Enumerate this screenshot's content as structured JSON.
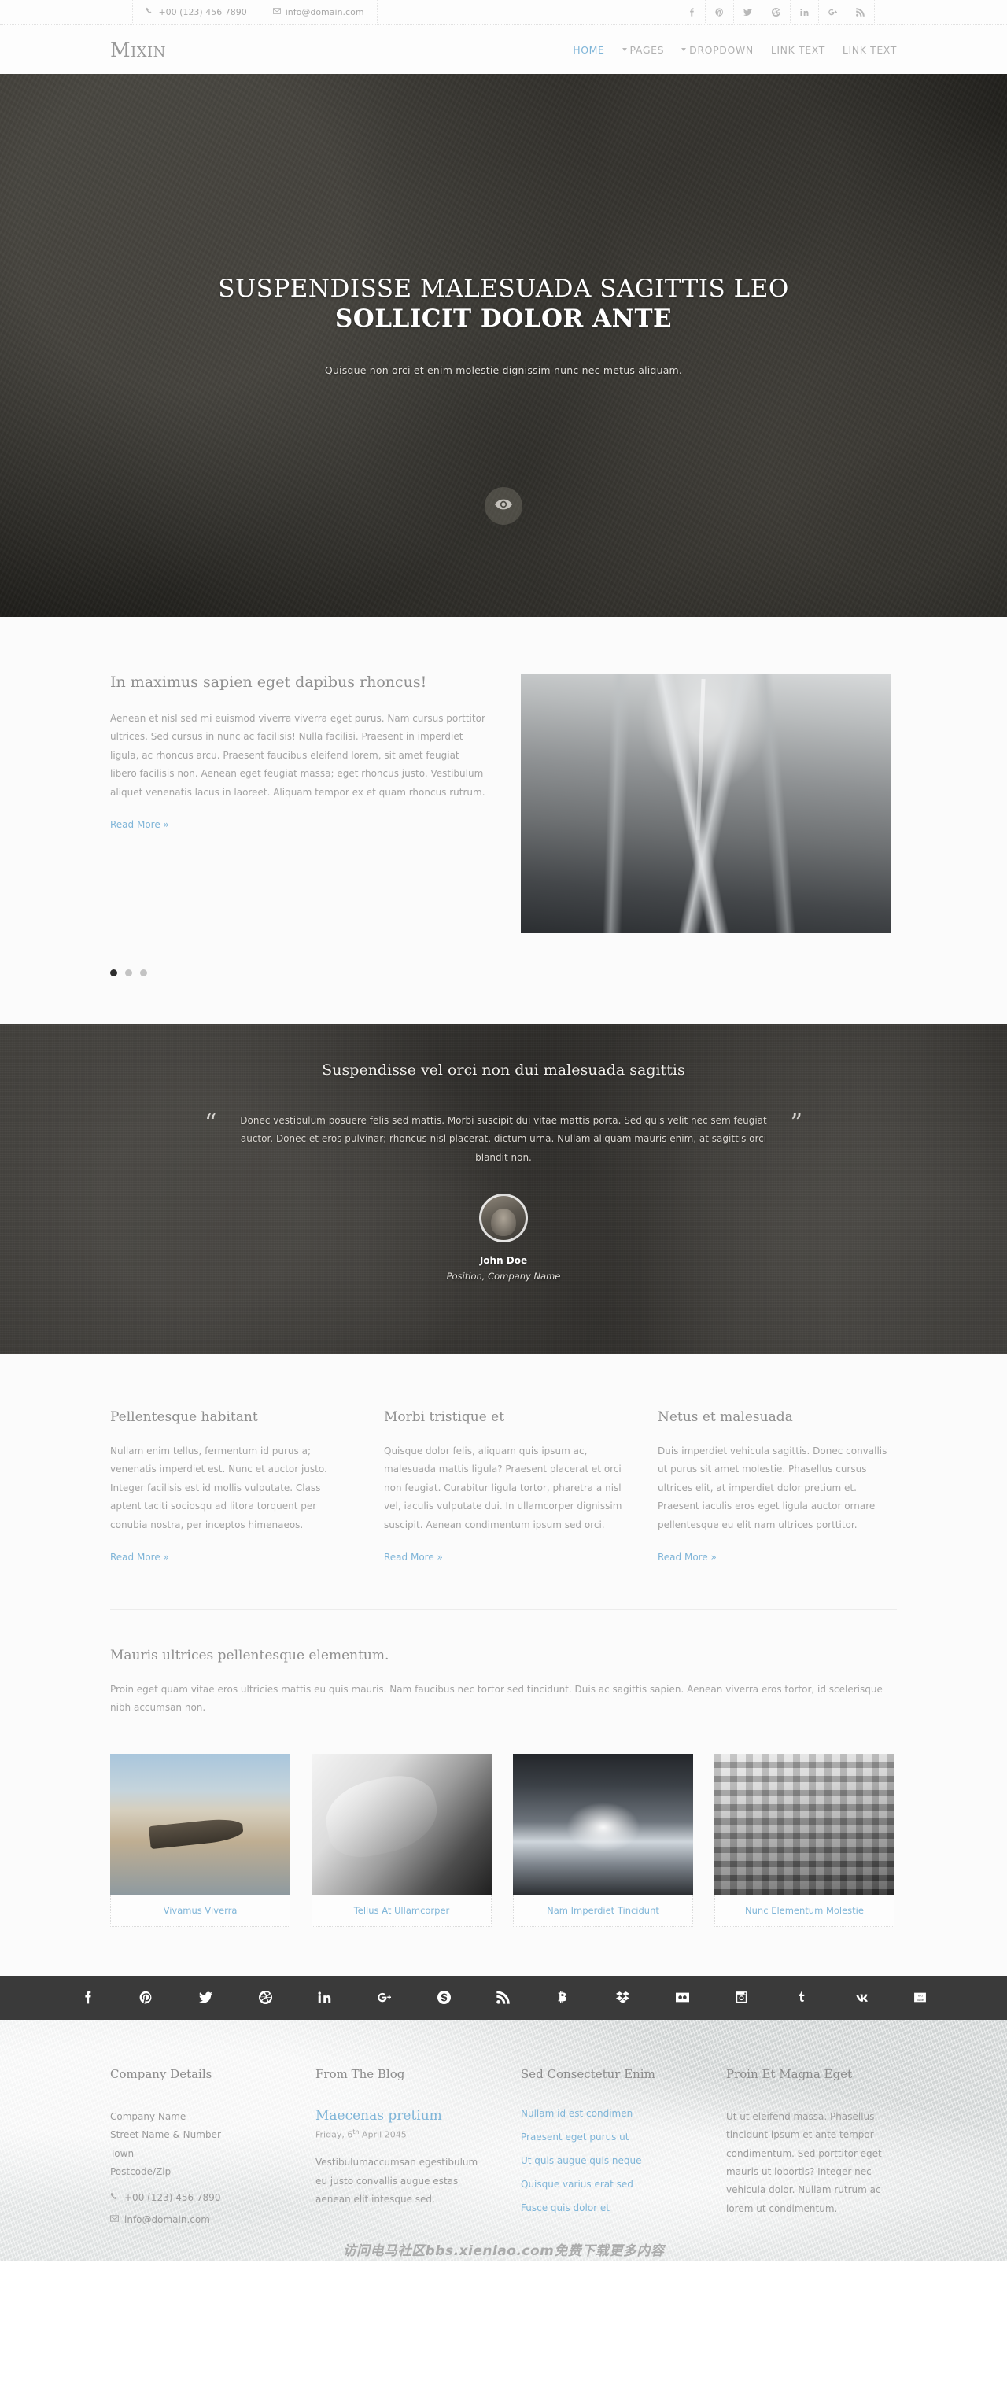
{
  "topbar": {
    "phone": "+00 (123) 456 7890",
    "email": "info@domain.com",
    "socials": [
      "facebook",
      "pinterest",
      "twitter",
      "dribbble",
      "linkedin",
      "googleplus",
      "rss"
    ]
  },
  "header": {
    "logo": "Mixin",
    "nav": [
      {
        "label": "HOME",
        "active": true,
        "caret": false
      },
      {
        "label": "PAGES",
        "active": false,
        "caret": true
      },
      {
        "label": "DROPDOWN",
        "active": false,
        "caret": true
      },
      {
        "label": "LINK TEXT",
        "active": false,
        "caret": false
      },
      {
        "label": "LINK TEXT",
        "active": false,
        "caret": false
      }
    ],
    "accent_color": "#7fb5d8"
  },
  "hero": {
    "title_line1": "SUSPENDISSE MALESUADA SAGITTIS LEO",
    "title_line2": "SOLLICIT DOLOR ANTE",
    "subtitle": "Quisque non orci et enim molestie dignissim nunc nec metus aliquam.",
    "scroll_icon": "eye-icon"
  },
  "intro": {
    "heading": "In maximus sapien eget dapibus rhoncus!",
    "body": "Aenean et nisl sed mi euismod viverra viverra eget purus. Nam cursus porttitor ultrices. Sed cursus in nunc ac facilisis! Nulla facilisi. Praesent in imperdiet ligula, ac rhoncus arcu. Praesent faucibus eleifend lorem, sit amet feugiat libero facilisis non. Aenean eget feugiat massa; eget rhoncus justo. Vestibulum aliquet venenatis lacus in laoreet. Aliquam tempor ex et quam rhoncus rutrum.",
    "read_more": "Read More »",
    "slider_dots": 3,
    "slider_active_index": 0
  },
  "testimonial": {
    "heading": "Suspendisse vel orci non dui malesuada sagittis",
    "quote": "Donec vestibulum posuere felis sed mattis. Morbi suscipit dui vitae mattis porta. Sed quis velit nec sem feugiat auctor. Donec et eros pulvinar; rhoncus nisl placerat, dictum urna. Nullam aliquam mauris enim, at sagittis orci blandit non.",
    "quote_open": "“",
    "quote_close": "”",
    "author_name": "John Doe",
    "author_position": "Position, Company Name"
  },
  "columns": [
    {
      "heading": "Pellentesque habitant",
      "body": "Nullam enim tellus, fermentum id purus a; venenatis imperdiet est. Nunc et auctor justo. Integer facilisis est id mollis vulputate. Class aptent taciti sociosqu ad litora torquent per conubia nostra, per inceptos himenaeos.",
      "read_more": "Read More »"
    },
    {
      "heading": "Morbi tristique et",
      "body": "Quisque dolor felis, aliquam quis ipsum ac, malesuada mattis ligula? Praesent placerat et orci non feugiat. Curabitur ligula tortor, pharetra a nisl vel, iaculis vulputate dui. In ullamcorper dignissim suscipit. Aenean condimentum ipsum sed orci.",
      "read_more": "Read More »"
    },
    {
      "heading": "Netus et malesuada",
      "body": "Duis imperdiet vehicula sagittis. Donec convallis ut purus sit amet molestie. Phasellus cursus ultrices elit, at imperdiet dolor pretium et. Praesent iaculis eros eget ligula auctor ornare pellentesque eu elit nam ultrices porttitor.",
      "read_more": "Read More »"
    }
  ],
  "gallery": {
    "heading": "Mauris ultrices pellentesque elementum.",
    "body": "Proin eget quam vitae eros ultricies mattis eu quis mauris. Nam faucibus nec tortor sed tincidunt. Duis ac sagittis sapien. Aenean viverra eros tortor, id scelerisque nibh accumsan non.",
    "items": [
      {
        "caption": "Vivamus Viverra"
      },
      {
        "caption": "Tellus At Ullamcorper"
      },
      {
        "caption": "Nam Imperdiet Tincidunt"
      },
      {
        "caption": "Nunc Elementum Molestie"
      }
    ]
  },
  "social_bar": {
    "icons": [
      "facebook",
      "pinterest",
      "twitter",
      "dribbble",
      "linkedin",
      "googleplus",
      "skype",
      "rss",
      "bitcoin",
      "dropbox",
      "flickr",
      "instagram",
      "tumblr",
      "vk",
      "youtube"
    ],
    "background": "#3a3a3a"
  },
  "footer": {
    "col1": {
      "heading": "Company Details",
      "company": "Company Name",
      "street": "Street Name & Number",
      "town": "Town",
      "postcode": "Postcode/Zip",
      "phone": "+00 (123) 456 7890",
      "email": "info@domain.com"
    },
    "col2": {
      "heading": "From The Blog",
      "post_title": "Maecenas pretium",
      "post_date_prefix": "Friday, 6",
      "post_date_sup": "th",
      "post_date_suffix": " April 2045",
      "post_excerpt": "Vestibulumaccumsan egestibulum eu justo convallis augue estas aenean elit intesque sed."
    },
    "col3": {
      "heading": "Sed Consectetur Enim",
      "links": [
        "Nullam id est condimen",
        "Praesent eget purus ut",
        "Ut quis augue quis neque",
        "Quisque varius erat sed",
        "Fusce quis dolor et"
      ]
    },
    "col4": {
      "heading": "Proin Et Magna Eget",
      "body": "Ut ut eleifend massa. Phasellus tincidunt ipsum et ante tempor condimentum. Sed porttitor eget mauris ut lobortis? Integer nec vehicula dolor. Nullam rutrum ac lorem ut condimentum."
    },
    "watermark": "访问电马社区bbs.xienlao.com免费下载更多内容"
  }
}
